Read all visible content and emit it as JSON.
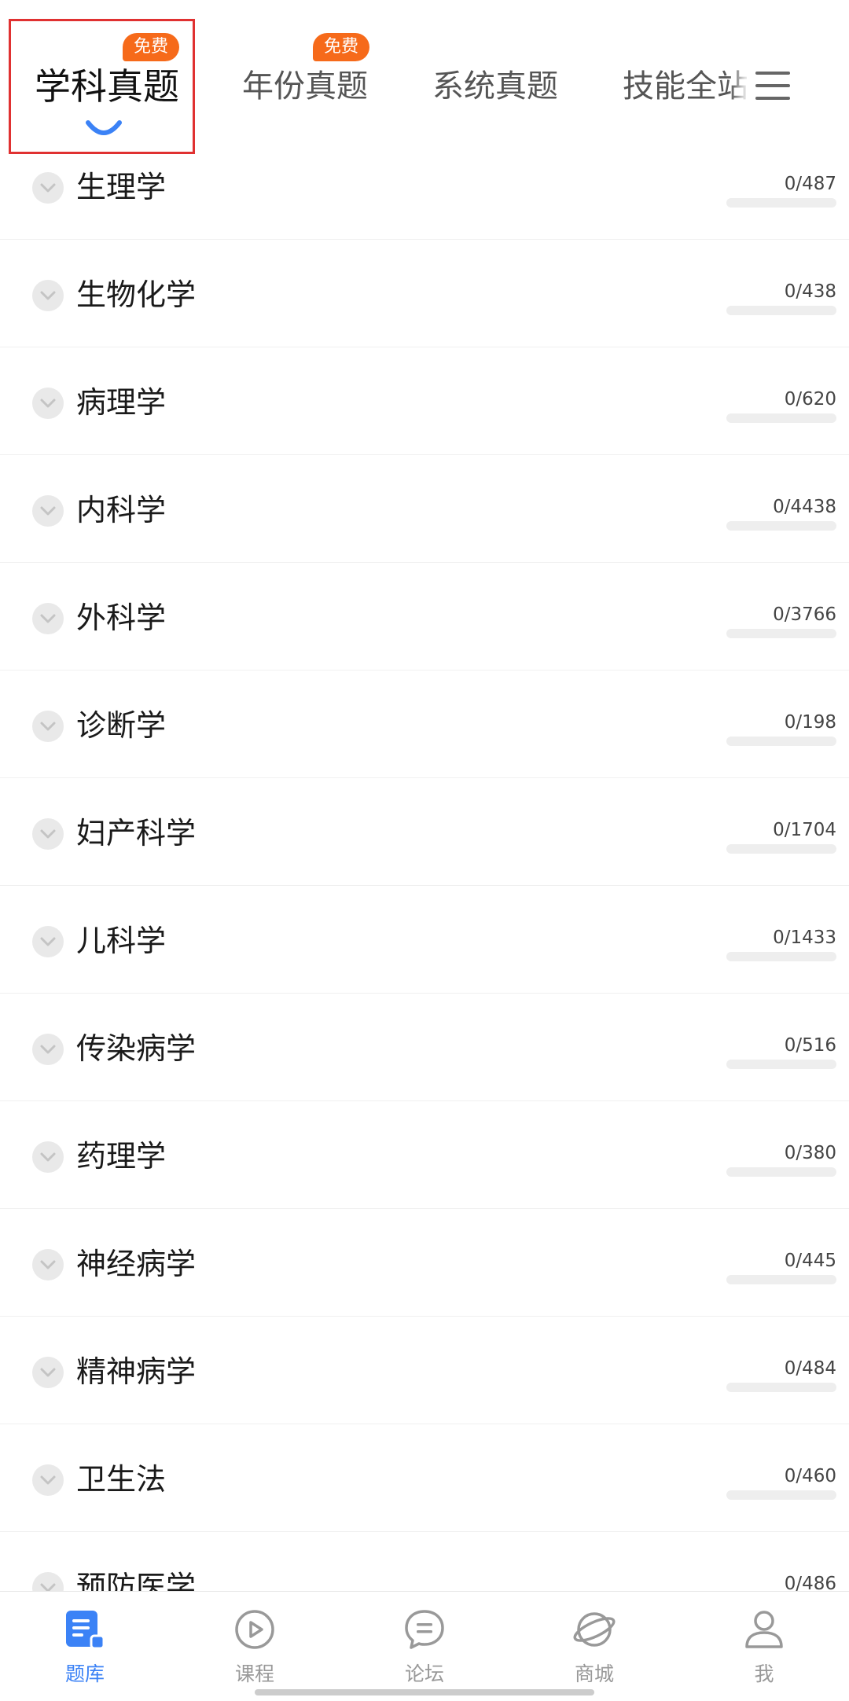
{
  "tabs": [
    {
      "label": "学科真题",
      "badge": "免费",
      "active": true
    },
    {
      "label": "年份真题",
      "badge": "免费",
      "active": false
    },
    {
      "label": "系统真题",
      "badge": "",
      "active": false
    },
    {
      "label": "技能全站真题",
      "badge": "",
      "active": false
    }
  ],
  "subjects": [
    {
      "name": "生理学",
      "count": "0/487",
      "progress": 0
    },
    {
      "name": "生物化学",
      "count": "0/438",
      "progress": 0
    },
    {
      "name": "病理学",
      "count": "0/620",
      "progress": 0
    },
    {
      "name": "内科学",
      "count": "0/4438",
      "progress": 0
    },
    {
      "name": "外科学",
      "count": "0/3766",
      "progress": 0
    },
    {
      "name": "诊断学",
      "count": "0/198",
      "progress": 0
    },
    {
      "name": "妇产科学",
      "count": "0/1704",
      "progress": 0
    },
    {
      "name": "儿科学",
      "count": "0/1433",
      "progress": 0
    },
    {
      "name": "传染病学",
      "count": "0/516",
      "progress": 0
    },
    {
      "name": "药理学",
      "count": "0/380",
      "progress": 0
    },
    {
      "name": "神经病学",
      "count": "0/445",
      "progress": 0
    },
    {
      "name": "精神病学",
      "count": "0/484",
      "progress": 0
    },
    {
      "name": "卫生法",
      "count": "0/460",
      "progress": 0
    },
    {
      "name": "预防医学",
      "count": "0/486",
      "progress": 0
    }
  ],
  "bottom_nav": [
    {
      "label": "题库",
      "icon": "question-bank-icon",
      "active": true
    },
    {
      "label": "课程",
      "icon": "play-circle-icon",
      "active": false
    },
    {
      "label": "论坛",
      "icon": "chat-bubble-icon",
      "active": false
    },
    {
      "label": "商城",
      "icon": "planet-icon",
      "active": false
    },
    {
      "label": "我",
      "icon": "user-icon",
      "active": false
    }
  ],
  "colors": {
    "accent": "#3b82f6",
    "badge": "#f66a1a",
    "highlight": "#e03131",
    "inactive": "#999999"
  }
}
